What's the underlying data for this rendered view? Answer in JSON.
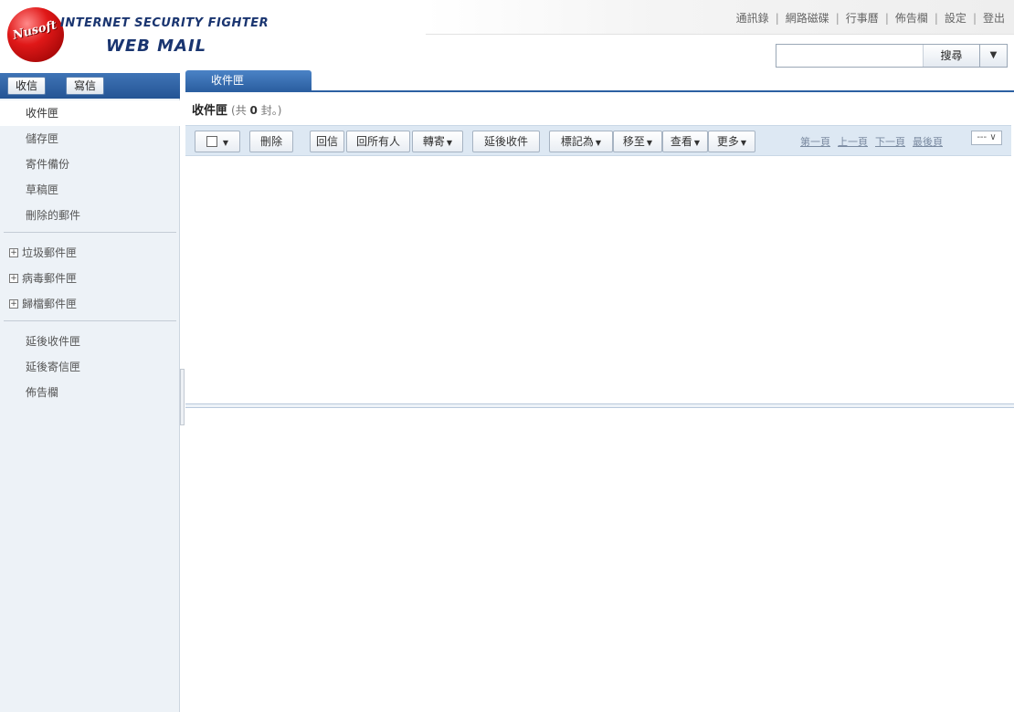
{
  "logo": {
    "ball_text": "Nusoft",
    "line1": "INTERNET SECURITY FIGHTER",
    "line2": "WEB MAIL"
  },
  "top_links": [
    "通訊錄",
    "網路磁碟",
    "行事曆",
    "佈告欄",
    "設定",
    "登出"
  ],
  "search": {
    "value": "",
    "button_label": "搜尋",
    "dropdown_icon": "▼"
  },
  "sidebar": {
    "receive_label": "收信",
    "compose_label": "寫信",
    "folders": [
      "收件匣",
      "儲存匣",
      "寄件備份",
      "草稿匣",
      "刪除的郵件"
    ],
    "tree_folders": [
      "垃圾郵件匣",
      "病毒郵件匣",
      "歸檔郵件匣"
    ],
    "extra_folders": [
      "延後收件匣",
      "延後寄信匣",
      "佈告欄"
    ]
  },
  "tab": {
    "label": "收件匣"
  },
  "folder_header": {
    "title": "收件匣",
    "count_prefix": "(共",
    "count": "0",
    "count_suffix": "封。)"
  },
  "toolbar": {
    "delete": "刪除",
    "reply": "回信",
    "reply_all": "回所有人",
    "forward": "轉寄",
    "defer": "延後收件",
    "mark_as": "標記為",
    "move_to": "移至",
    "view": "查看",
    "more": "更多",
    "caret": "▼"
  },
  "pager": {
    "first": "第一頁",
    "prev": "上一頁",
    "next": "下一頁",
    "last": "最後頁",
    "page_select": "--- ∨"
  }
}
